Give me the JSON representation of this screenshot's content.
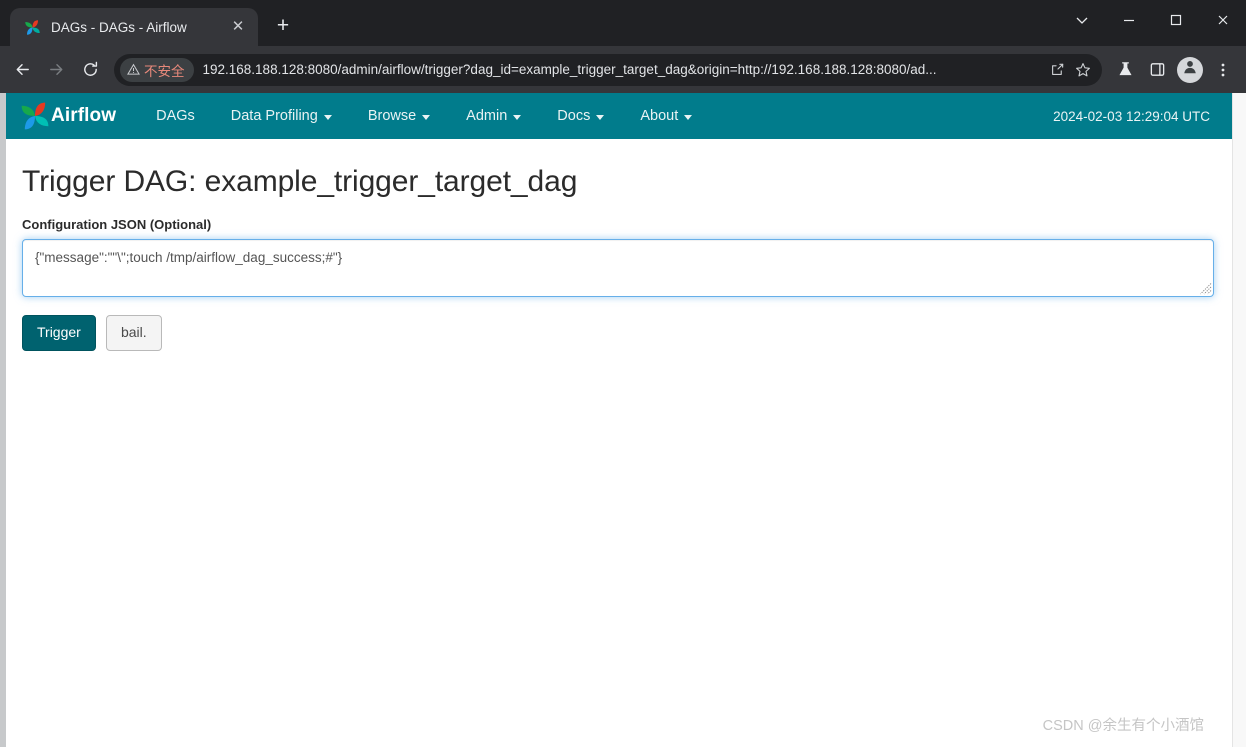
{
  "browser": {
    "tab": {
      "title": "DAGs - DAGs - Airflow",
      "favicon_icon": "airflow-pinwheel-icon",
      "close_icon": "close-icon"
    },
    "new_tab_label": "+",
    "window_controls": {
      "tab_search_icon": "chevron-down-icon",
      "minimize_icon": "minimize-icon",
      "maximize_icon": "maximize-icon",
      "close_icon": "close-icon"
    },
    "toolbar": {
      "back_icon": "back-arrow-icon",
      "forward_icon": "forward-arrow-icon",
      "reload_icon": "reload-icon",
      "security_label": "不安全",
      "security_icon": "warning-triangle-icon",
      "url": "192.168.188.128:8080/admin/airflow/trigger?dag_id=example_trigger_target_dag&origin=http://192.168.188.128:8080/ad...",
      "share_icon": "share-icon",
      "bookmark_icon": "star-icon",
      "experiments_icon": "flask-icon",
      "side_panel_icon": "side-panel-icon",
      "profile_icon": "person-avatar-icon",
      "menu_icon": "three-dot-menu-icon"
    }
  },
  "airflow": {
    "brand": "Airflow",
    "brand_logo_icon": "airflow-pinwheel-icon",
    "nav_items": [
      {
        "label": "DAGs",
        "has_caret": false
      },
      {
        "label": "Data Profiling",
        "has_caret": true
      },
      {
        "label": "Browse",
        "has_caret": true
      },
      {
        "label": "Admin",
        "has_caret": true
      },
      {
        "label": "Docs",
        "has_caret": true
      },
      {
        "label": "About",
        "has_caret": true
      }
    ],
    "clock": "2024-02-03 12:29:04 UTC",
    "navbar_color": "#017c8c"
  },
  "main": {
    "page_title": "Trigger DAG: example_trigger_target_dag",
    "config_label": "Configuration JSON (Optional)",
    "config_value": "{\"message\":\"\"\\\";touch /tmp/airflow_dag_success;#\"}",
    "config_placeholder": "",
    "trigger_button": "Trigger",
    "cancel_button": "bail.",
    "primary_color": "#00626f",
    "focus_border_color": "#66afe9"
  },
  "watermark": "CSDN @余生有个小酒馆"
}
